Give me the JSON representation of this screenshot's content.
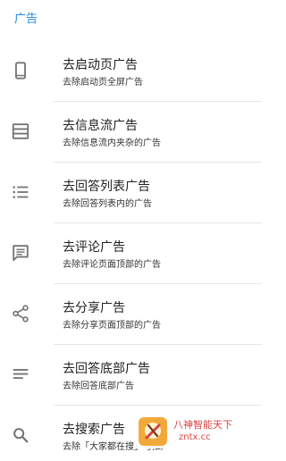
{
  "header": {
    "title": "广告"
  },
  "items": [
    {
      "icon": "phone-icon",
      "title": "去启动页广告",
      "subtitle": "去除启动页全屏广告"
    },
    {
      "icon": "feed-list-icon",
      "title": "去信息流广告",
      "subtitle": "去除信息流内夹杂的广告"
    },
    {
      "icon": "bullet-list-icon",
      "title": "去回答列表广告",
      "subtitle": "去除回答列表内的广告"
    },
    {
      "icon": "comment-icon",
      "title": "去评论广告",
      "subtitle": "去除评论页面顶部的广告"
    },
    {
      "icon": "share-icon",
      "title": "去分享广告",
      "subtitle": "去除分享页面顶部的广告"
    },
    {
      "icon": "lines-icon",
      "title": "去回答底部广告",
      "subtitle": "去除回答底部广告"
    },
    {
      "icon": "search-icon",
      "title": "去搜索广告",
      "subtitle": "去除「大家都在搜」与推广"
    }
  ],
  "watermark": {
    "text": "八神智能天下",
    "url": "zntx.cc"
  },
  "colors": {
    "accent": "#1e88e5",
    "icon": "#757575",
    "divider": "#e6e6e6",
    "watermark": "#d64545"
  }
}
